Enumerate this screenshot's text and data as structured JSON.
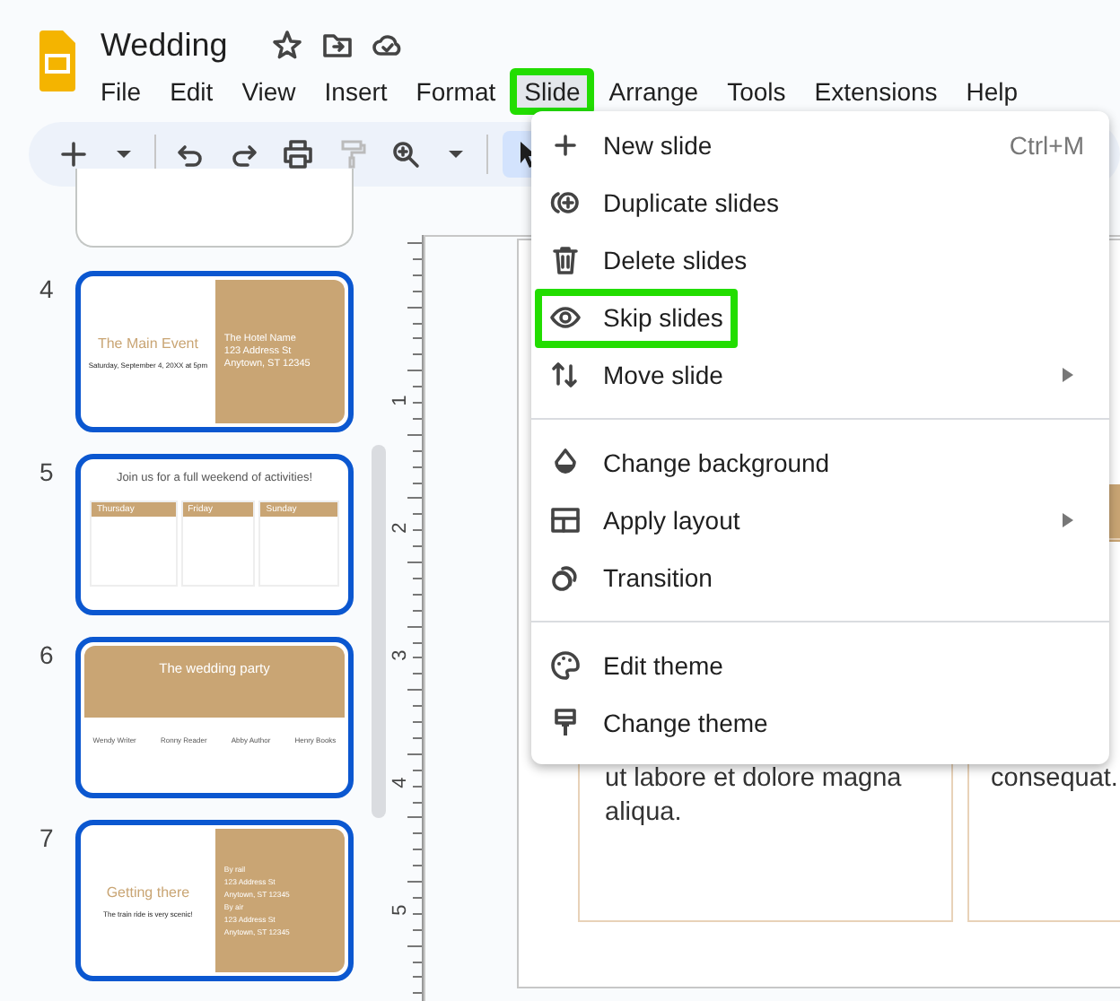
{
  "document": {
    "title": "Wedding"
  },
  "menubar": [
    {
      "label": "File",
      "highlighted": false
    },
    {
      "label": "Edit",
      "highlighted": false
    },
    {
      "label": "View",
      "highlighted": false
    },
    {
      "label": "Insert",
      "highlighted": false
    },
    {
      "label": "Format",
      "highlighted": false
    },
    {
      "label": "Slide",
      "highlighted": true
    },
    {
      "label": "Arrange",
      "highlighted": false
    },
    {
      "label": "Tools",
      "highlighted": false
    },
    {
      "label": "Extensions",
      "highlighted": false
    },
    {
      "label": "Help",
      "highlighted": false
    }
  ],
  "slide_menu": [
    {
      "kind": "item",
      "label": "New slide",
      "shortcut": "Ctrl+M",
      "submenu": false,
      "highlighted": false
    },
    {
      "kind": "item",
      "label": "Duplicate slides",
      "submenu": false,
      "highlighted": false
    },
    {
      "kind": "item",
      "label": "Delete slides",
      "submenu": false,
      "highlighted": false
    },
    {
      "kind": "item",
      "label": "Skip slides",
      "submenu": false,
      "highlighted": true
    },
    {
      "kind": "item",
      "label": "Move slide",
      "submenu": true,
      "highlighted": false
    },
    {
      "kind": "divider"
    },
    {
      "kind": "item",
      "label": "Change background",
      "submenu": false,
      "highlighted": false
    },
    {
      "kind": "item",
      "label": "Apply layout",
      "submenu": true,
      "highlighted": false
    },
    {
      "kind": "item",
      "label": "Transition",
      "submenu": false,
      "highlighted": false
    },
    {
      "kind": "divider"
    },
    {
      "kind": "item",
      "label": "Edit theme",
      "submenu": false,
      "highlighted": false
    },
    {
      "kind": "item",
      "label": "Change theme",
      "submenu": false,
      "highlighted": false
    }
  ],
  "filmstrip": [
    {
      "kind": "split",
      "number": "4",
      "selected": true,
      "title": "The Main Event",
      "subtitle": "Saturday, September 4, 20XX at 5pm",
      "panel_lines": [
        "The Hotel Name",
        "123 Address St",
        "Anytown, ST 12345"
      ]
    },
    {
      "kind": "columns",
      "number": "5",
      "selected": true,
      "title": "Join us for a full weekend of activities!",
      "columns": [
        "Thursday",
        "Friday",
        "Sunday"
      ]
    },
    {
      "kind": "banner",
      "number": "6",
      "selected": true,
      "title": "The wedding party",
      "people": [
        "Wendy Writer",
        "Ronny Reader",
        "Abby Author",
        "Henry Books"
      ]
    },
    {
      "kind": "split",
      "number": "7",
      "selected": true,
      "title": "Getting there",
      "subtitle": "The train ride is very scenic!",
      "panel_lines": [
        "By rail",
        "123 Address St",
        "Anytown, ST 12345",
        "By air",
        "123 Address St",
        "Anytown, ST 12345"
      ]
    }
  ],
  "ruler": [
    "1",
    "2",
    "3",
    "4",
    "5"
  ],
  "slide": {
    "left_box": [
      "ut labore et dolore magna",
      "aliqua."
    ],
    "right_box": [
      "consequat."
    ]
  }
}
